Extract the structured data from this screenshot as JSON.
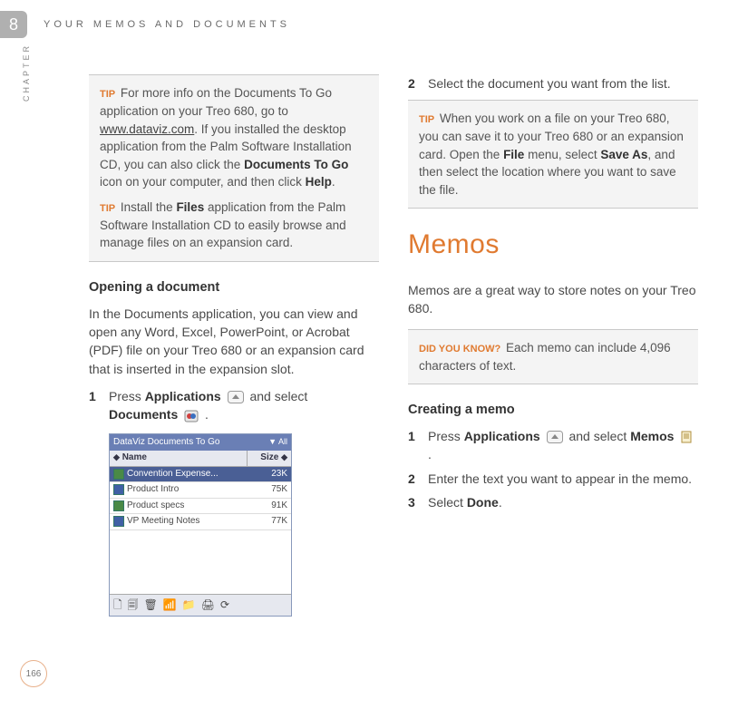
{
  "chapter": {
    "number": "8",
    "label": "CHAPTER",
    "header": "YOUR MEMOS AND DOCUMENTS"
  },
  "pageNumber": "166",
  "left": {
    "tip1_label": "TIP",
    "tip1_a": "For more info on the Documents To Go application on your Treo 680, go to ",
    "tip1_link": "www.dataviz.com",
    "tip1_b": ". If you installed the desktop application from the Palm Software Installation CD, you can also click the ",
    "tip1_bold1": "Documents To Go",
    "tip1_c": " icon on your computer, and then click ",
    "tip1_bold2": "Help",
    "tip1_d": ".",
    "tip2_label": "TIP",
    "tip2_a": "Install the ",
    "tip2_bold": "Files",
    "tip2_b": " application from the Palm Software Installation CD to easily browse and manage files on an expansion card.",
    "heading": "Opening a document",
    "intro": "In the Documents application, you can view and open any Word, Excel, PowerPoint, or Acrobat (PDF) file on your Treo 680 or an expansion card that is inserted in the expansion slot.",
    "step1_a": "Press ",
    "step1_b1": "Applications",
    "step1_b": " and select ",
    "step1_b2": "Documents",
    "step1_c": " .",
    "screenshot": {
      "title": "DataViz Documents To Go",
      "filter": "All",
      "colName": "Name",
      "colSize": "Size",
      "rows": [
        {
          "name": "Convention Expense...",
          "size": "23K",
          "type": "x",
          "sel": true
        },
        {
          "name": "Product Intro",
          "size": "75K",
          "type": "w",
          "sel": false
        },
        {
          "name": "Product specs",
          "size": "91K",
          "type": "x",
          "sel": false
        },
        {
          "name": "VP Meeting Notes",
          "size": "77K",
          "type": "w",
          "sel": false
        }
      ]
    }
  },
  "right": {
    "step2": "Select the document you want from the list.",
    "tip_label": "TIP",
    "tip_a": "When you work on a file on your Treo 680, you can save it to your Treo 680 or an expansion card. Open the ",
    "tip_b1": "File",
    "tip_b": " menu, select ",
    "tip_b2": "Save As",
    "tip_c": ", and then select the location where you want to save the file.",
    "section": "Memos",
    "intro": "Memos are a great way to store notes on your Treo 680.",
    "dyk_label": "DID YOU KNOW?",
    "dyk": "Each memo can include 4,096 characters of text.",
    "heading2": "Creating a memo",
    "m1_a": "Press ",
    "m1_b1": "Applications",
    "m1_b": " and select ",
    "m1_b2": "Memos",
    "m1_c": " .",
    "m2": "Enter the text you want to appear in the memo.",
    "m3_a": "Select ",
    "m3_b": "Done",
    "m3_c": "."
  }
}
